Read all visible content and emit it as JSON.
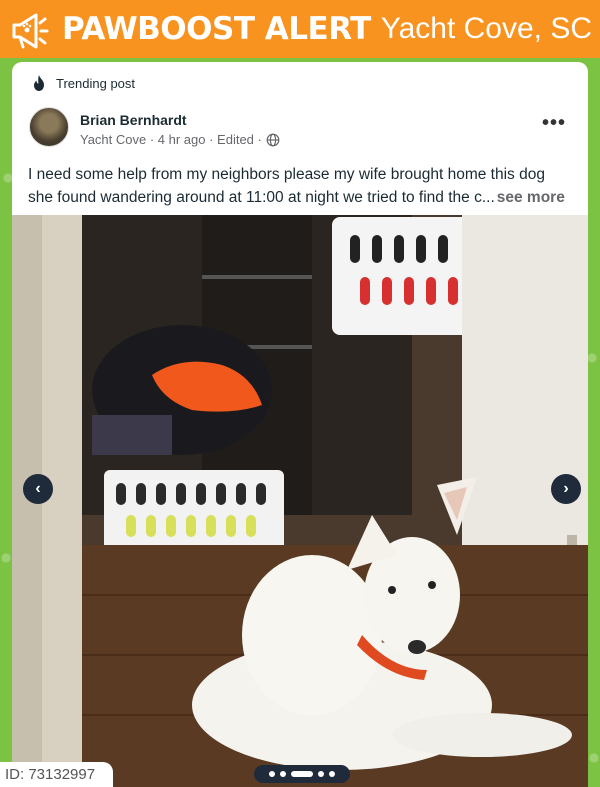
{
  "banner": {
    "brand": "PAWBOOST ALERT",
    "location": "Yacht Cove, SC",
    "icon": "megaphone-paw-icon",
    "color": "#f7931e"
  },
  "post": {
    "trending_label": "Trending post",
    "author": "Brian Bernhardt",
    "meta": "Yacht Cove · 4 hr ago · Edited ·",
    "text_line1": "I need some help from my neighbors please my wife brought home this dog",
    "text_line2": "she found wandering around at 11:00 at night we tried to find the c...",
    "see_more": "see more",
    "more_icon": "•••"
  },
  "photo": {
    "prev_icon": "‹",
    "next_icon": "›",
    "dots": 5,
    "active_dot": 2
  },
  "id_tag": "ID: 73132997",
  "colors": {
    "background": "#7cc243",
    "nav": "#1f2a3a"
  }
}
